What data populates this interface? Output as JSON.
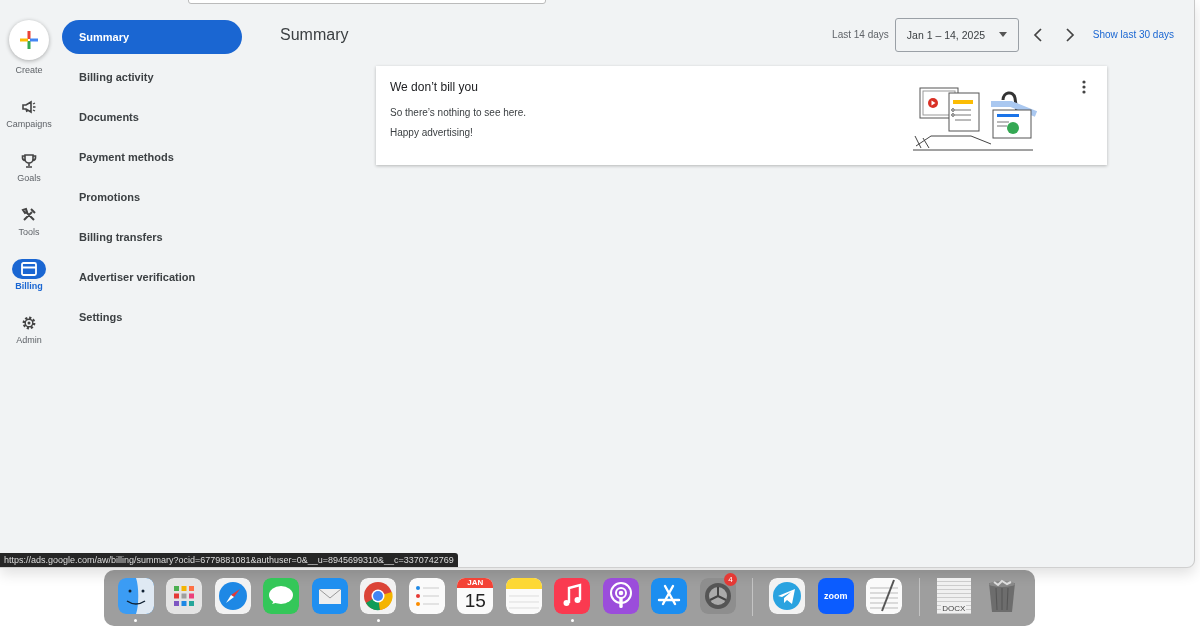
{
  "rail": [
    {
      "kind": "create",
      "label": "Create",
      "selected": false
    },
    {
      "kind": "campaigns",
      "label": "Campaigns",
      "selected": false
    },
    {
      "kind": "goals",
      "label": "Goals",
      "selected": false
    },
    {
      "kind": "tools",
      "label": "Tools",
      "selected": false
    },
    {
      "kind": "billing",
      "label": "Billing",
      "selected": true
    },
    {
      "kind": "admin",
      "label": "Admin",
      "selected": false
    }
  ],
  "nav": [
    {
      "label": "Summary",
      "selected": true
    },
    {
      "label": "Billing activity",
      "selected": false
    },
    {
      "label": "Documents",
      "selected": false
    },
    {
      "label": "Payment methods",
      "selected": false
    },
    {
      "label": "Promotions",
      "selected": false
    },
    {
      "label": "Billing transfers",
      "selected": false
    },
    {
      "label": "Advertiser verification",
      "selected": false
    },
    {
      "label": "Settings",
      "selected": false
    }
  ],
  "header": {
    "title": "Summary",
    "range_label": "Last 14 days",
    "date_range": "Jan 1 – 14, 2025",
    "link": "Show last 30 days"
  },
  "card": {
    "title": "We don’t bill you",
    "lines": [
      "So there’s nothing to see here.",
      "Happy advertising!"
    ]
  },
  "status_url": "https://ads.google.com/aw/billing/summary?ocid=6779881081&authuser=0&__u=8945699310&__c=3370742769",
  "dock": {
    "sections": [
      [
        {
          "kind": "finder",
          "running": true
        },
        {
          "kind": "launchpad",
          "running": false
        },
        {
          "kind": "safari",
          "running": false
        },
        {
          "kind": "messages",
          "running": false
        },
        {
          "kind": "mail",
          "running": false
        },
        {
          "kind": "chrome",
          "running": true
        },
        {
          "kind": "reminders",
          "running": false
        },
        {
          "kind": "calendar",
          "running": false,
          "month": "JAN",
          "day": "15"
        },
        {
          "kind": "notes",
          "running": false
        },
        {
          "kind": "music",
          "running": true
        },
        {
          "kind": "podcasts",
          "running": false
        },
        {
          "kind": "appstore",
          "running": false
        },
        {
          "kind": "settings",
          "running": false,
          "badge": "4"
        }
      ],
      [
        {
          "kind": "telegram",
          "running": false
        },
        {
          "kind": "zoom",
          "running": false,
          "text": "zoom"
        },
        {
          "kind": "textedit",
          "running": false
        }
      ],
      [
        {
          "kind": "document",
          "running": false,
          "text": "DOCX"
        },
        {
          "kind": "trash",
          "running": false
        }
      ]
    ]
  }
}
